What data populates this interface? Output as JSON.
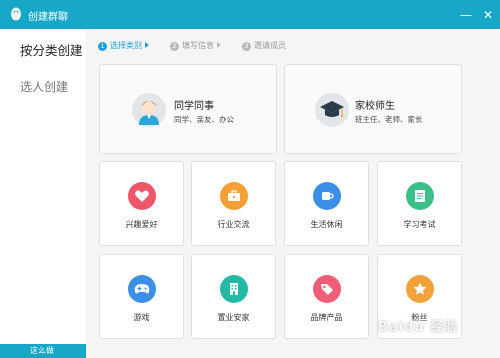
{
  "window": {
    "title": "创建群聊",
    "min_label": "—",
    "close_label": "✕"
  },
  "sidebar": {
    "items": [
      {
        "label": "按分类创建"
      },
      {
        "label": "选人创建"
      }
    ]
  },
  "steps": [
    {
      "num": "1",
      "label": "选择类别"
    },
    {
      "num": "2",
      "label": "填写信息"
    },
    {
      "num": "3",
      "label": "邀请成员"
    }
  ],
  "categories": {
    "big": [
      {
        "title": "同学同事",
        "subtitle": "同学、亲友、办公",
        "icon": "person-icon"
      },
      {
        "title": "家校师生",
        "subtitle": "班主任、老师、家长",
        "icon": "graduation-cap-icon"
      }
    ],
    "small": [
      {
        "label": "兴趣爱好",
        "icon": "heart-icon",
        "color": "#f0566a"
      },
      {
        "label": "行业交流",
        "icon": "briefcase-icon",
        "color": "#f5a035"
      },
      {
        "label": "生活休闲",
        "icon": "cup-icon",
        "color": "#3b8fe6"
      },
      {
        "label": "学习考试",
        "icon": "notebook-icon",
        "color": "#3cbf88"
      },
      {
        "label": "游戏",
        "icon": "gamepad-icon",
        "color": "#3b8fe6"
      },
      {
        "label": "置业安家",
        "icon": "building-icon",
        "color": "#23b9a6"
      },
      {
        "label": "品牌产品",
        "icon": "tag-icon",
        "color": "#ee5f77"
      },
      {
        "label": "粉丝",
        "icon": "star-icon",
        "color": "#f3a23a"
      }
    ]
  },
  "watermark": "Baidu 经验",
  "bottom": {
    "text": "这么做"
  }
}
